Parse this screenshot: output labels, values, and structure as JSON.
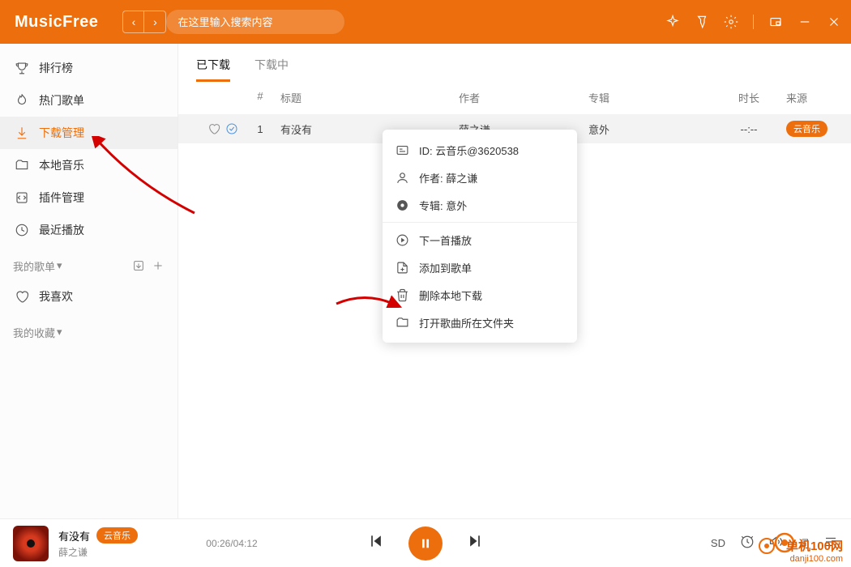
{
  "app": {
    "name": "MusicFree"
  },
  "search": {
    "placeholder": "在这里输入搜索内容"
  },
  "sidebar": {
    "items": [
      {
        "label": "排行榜"
      },
      {
        "label": "热门歌单"
      },
      {
        "label": "下载管理"
      },
      {
        "label": "本地音乐"
      },
      {
        "label": "插件管理"
      },
      {
        "label": "最近播放"
      }
    ],
    "sections": [
      {
        "label": "我的歌单"
      },
      {
        "label": "我喜欢"
      },
      {
        "label": "我的收藏"
      }
    ]
  },
  "tabs": [
    {
      "label": "已下载",
      "active": true
    },
    {
      "label": "下载中",
      "active": false
    }
  ],
  "columns": {
    "idx": "#",
    "title": "标题",
    "artist": "作者",
    "album": "专辑",
    "duration": "时长",
    "source": "来源"
  },
  "rows": [
    {
      "idx": "1",
      "title": "有没有",
      "artist": "薛之谦",
      "album": "意外",
      "duration": "--:--",
      "source": "云音乐"
    }
  ],
  "context_menu": {
    "info": [
      {
        "label": "ID: 云音乐@3620538"
      },
      {
        "label": "作者: 薛之谦"
      },
      {
        "label": "专辑: 意外"
      }
    ],
    "actions": [
      {
        "label": "下一首播放"
      },
      {
        "label": "添加到歌单"
      },
      {
        "label": "删除本地下载"
      },
      {
        "label": "打开歌曲所在文件夹"
      }
    ]
  },
  "player": {
    "title": "有没有",
    "artist": "薛之谦",
    "source": "云音乐",
    "time": "00:26/04:12",
    "quality": "SD",
    "lyric": "词"
  },
  "watermark": {
    "line1": "单机100网",
    "line2": "danji100.com"
  }
}
